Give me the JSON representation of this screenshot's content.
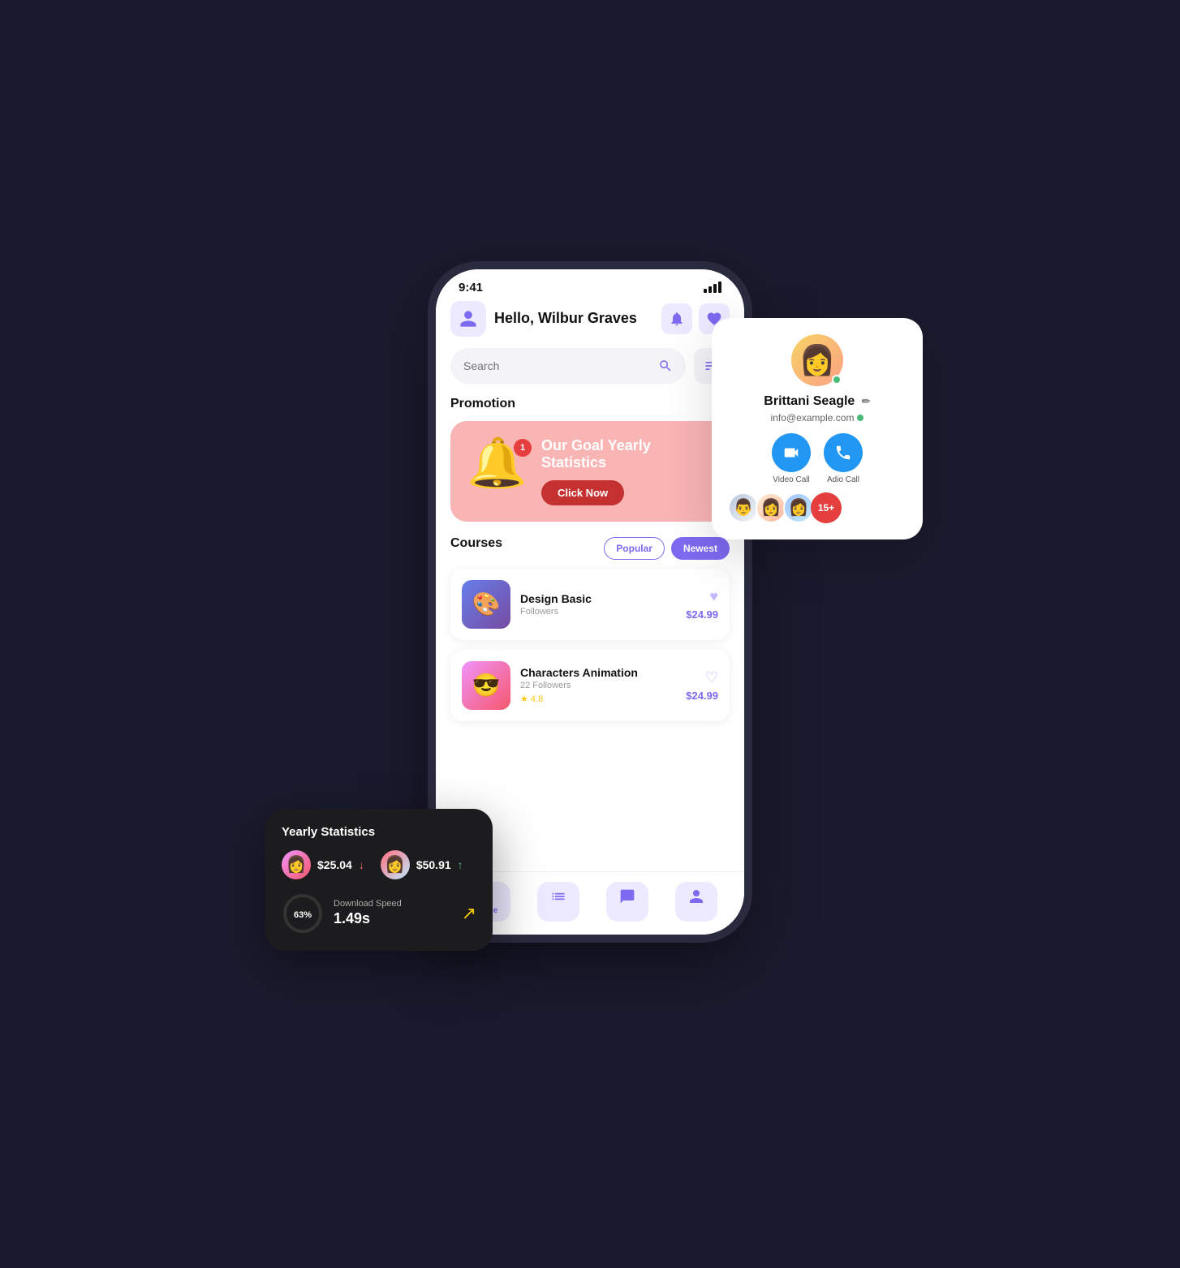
{
  "phone": {
    "status_bar": {
      "time": "9:41"
    },
    "header": {
      "greeting": "Hello, Wilbur Graves"
    },
    "search": {
      "placeholder": "Search"
    },
    "promotion": {
      "section_label": "Promotion",
      "card_title": "Our Goal Yearly Statistics",
      "bell_badge": "1",
      "cta_button": "Click Now"
    },
    "courses": {
      "section_label": "Courses",
      "tabs": [
        "Popular",
        "Newest"
      ],
      "items": [
        {
          "name": "Design Basic",
          "followers": "Followers",
          "price": "$24.99",
          "emoji": "🎨"
        },
        {
          "name": "Characters Animation",
          "followers": "22 Followers",
          "rating": "4.8",
          "price": "$24.99",
          "emoji": "😎"
        }
      ]
    },
    "bottom_nav": {
      "items": [
        "Home",
        "",
        "",
        ""
      ]
    }
  },
  "stats_card": {
    "title": "Yearly Statistics",
    "stat1": {
      "value": "$25.04",
      "direction": "down"
    },
    "stat2": {
      "value": "$50.91",
      "direction": "up"
    },
    "download": {
      "label": "Download Speed",
      "speed": "1.49s",
      "percent": 63
    }
  },
  "contact_card": {
    "name": "Brittani Seagle",
    "email": "info@example.com",
    "video_call_label": "Video Call",
    "audio_call_label": "Adio Call",
    "followers_extra": "15+"
  }
}
